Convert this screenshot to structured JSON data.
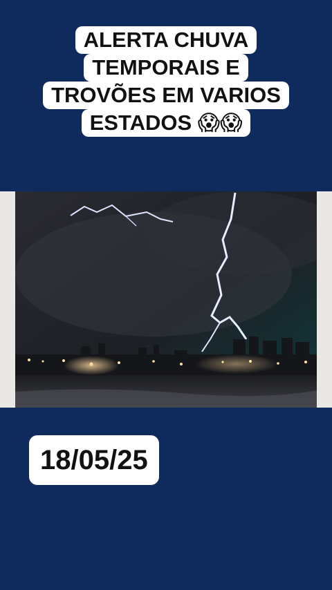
{
  "headline": {
    "lines": [
      "ALERTA CHUVA",
      "TEMPORAIS E",
      "TROVÕES EM VARIOS",
      "ESTADOS 😱😱"
    ]
  },
  "date": "18/05/25",
  "colors": {
    "background": "#0f2a5c",
    "label_bg": "#ffffff",
    "text": "#111111"
  },
  "photo": {
    "icon": "lightning-storm-image"
  }
}
